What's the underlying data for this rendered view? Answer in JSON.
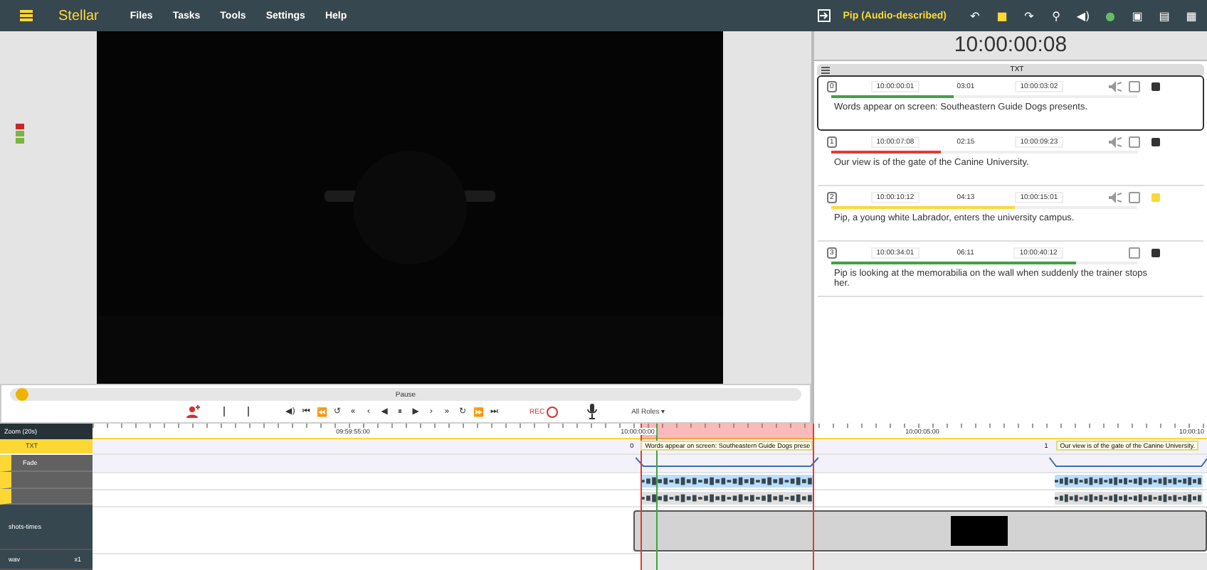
{
  "app": {
    "logo": "Stellar",
    "menu": [
      "Files",
      "Tasks",
      "Tools",
      "Settings",
      "Help"
    ],
    "project": "Pip (Audio-described)"
  },
  "toolbar": [
    {
      "glyph": "↶",
      "kind": "plain"
    },
    {
      "glyph": "■",
      "kind": "accent"
    },
    {
      "glyph": "↷",
      "kind": "plain"
    },
    {
      "glyph": "⚲",
      "kind": "plain"
    },
    {
      "glyph": "◀)",
      "kind": "plain"
    },
    {
      "glyph": "●",
      "kind": "user"
    },
    {
      "glyph": "▣",
      "kind": "plain"
    },
    {
      "glyph": "▤",
      "kind": "plain"
    },
    {
      "glyph": "▦",
      "kind": "plain"
    }
  ],
  "timecode": "10:00:00:08",
  "panel_title": "TXT",
  "events": [
    {
      "index": "0",
      "start": "10:00:00:01",
      "duration": "03:01",
      "end": "10:00:03:02",
      "text": "Words appear on screen: Southeastern Guide Dogs presents.",
      "color": "#43a047",
      "level": 0.4,
      "selected": true,
      "voice": true,
      "checked": false,
      "flagged": false
    },
    {
      "index": "1",
      "start": "10:00:07:08",
      "duration": "02:15",
      "end": "10:00:09:23",
      "text": "Our view is of the gate of the Canine University.",
      "color": "#e53935",
      "level": 0.36,
      "selected": false,
      "voice": true,
      "checked": false,
      "flagged": false
    },
    {
      "index": "2",
      "start": "10:00:10:12",
      "duration": "04:13",
      "end": "10:00:15:01",
      "text": "Pip, a young white Labrador, enters the university campus.",
      "color": "#fdd835",
      "level": 0.6,
      "selected": false,
      "voice": true,
      "checked": false,
      "flagged": true
    },
    {
      "index": "3",
      "start": "10:00:34:01",
      "duration": "06:11",
      "end": "10:00:40:12",
      "text": "Pip is looking at the memorabilia on the wall when suddenly the trainer stops her.",
      "color": "#43a047",
      "level": 0.8,
      "selected": false,
      "voice": false,
      "checked": false,
      "flagged": false
    }
  ],
  "player": {
    "status": "Pause",
    "level": 0.01,
    "transport": [
      "◀)",
      "⏮",
      "⏪",
      "↺",
      "«",
      "‹",
      "◀",
      "⏸",
      "▶",
      "›",
      "»",
      "↻",
      "⏩",
      "⏭"
    ],
    "rec": "REC",
    "roles": "All Roles ▾"
  },
  "timeline": {
    "zoom": "Zoom (20s)",
    "ruler": [
      "09:59:55:00",
      "10:00:00:00",
      "10:00:05:00",
      "10:00:10"
    ],
    "tracks": [
      {
        "name": "TXT",
        "kind": "text"
      },
      {
        "name": "Fade",
        "kind": "fade"
      },
      {
        "kind": "audio"
      },
      {
        "kind": "audio2"
      },
      {
        "name": "shots-times",
        "kind": "shots"
      },
      {
        "name": "wav",
        "kind": "wav",
        "speed": "x1"
      }
    ],
    "clips": [
      {
        "index": "0",
        "text": "Words appear on screen: Southeastern Guide Dogs prese"
      },
      {
        "index": "1",
        "text": "Our view is of the gate of the Canine University."
      }
    ]
  }
}
